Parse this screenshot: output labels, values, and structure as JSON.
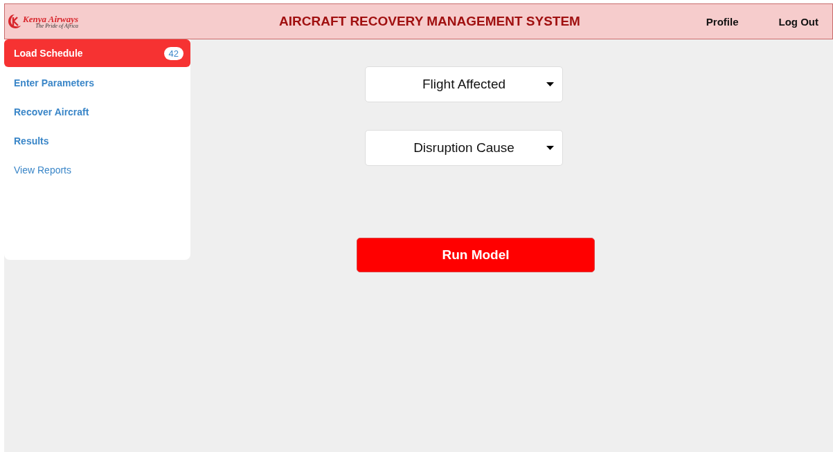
{
  "header": {
    "logo": {
      "brand": "Kenya Airways",
      "tagline": "The Pride of Africa"
    },
    "title": "AIRCRAFT RECOVERY MANAGEMENT SYSTEM",
    "links": [
      "Profile",
      "Log Out"
    ]
  },
  "sidebar": {
    "items": [
      {
        "label": "Load Schedule",
        "selected": true,
        "badge": "42"
      },
      {
        "label": "Enter Parameters",
        "selected": false
      },
      {
        "label": "Recover Aircraft",
        "selected": false
      },
      {
        "label": "Results",
        "selected": false
      },
      {
        "label": "View Reports",
        "selected": false,
        "bold": false
      }
    ]
  },
  "dropdowns": [
    {
      "placeholder": "Flight Affected"
    },
    {
      "placeholder": "Disruption Cause"
    }
  ],
  "button": "Run Model"
}
